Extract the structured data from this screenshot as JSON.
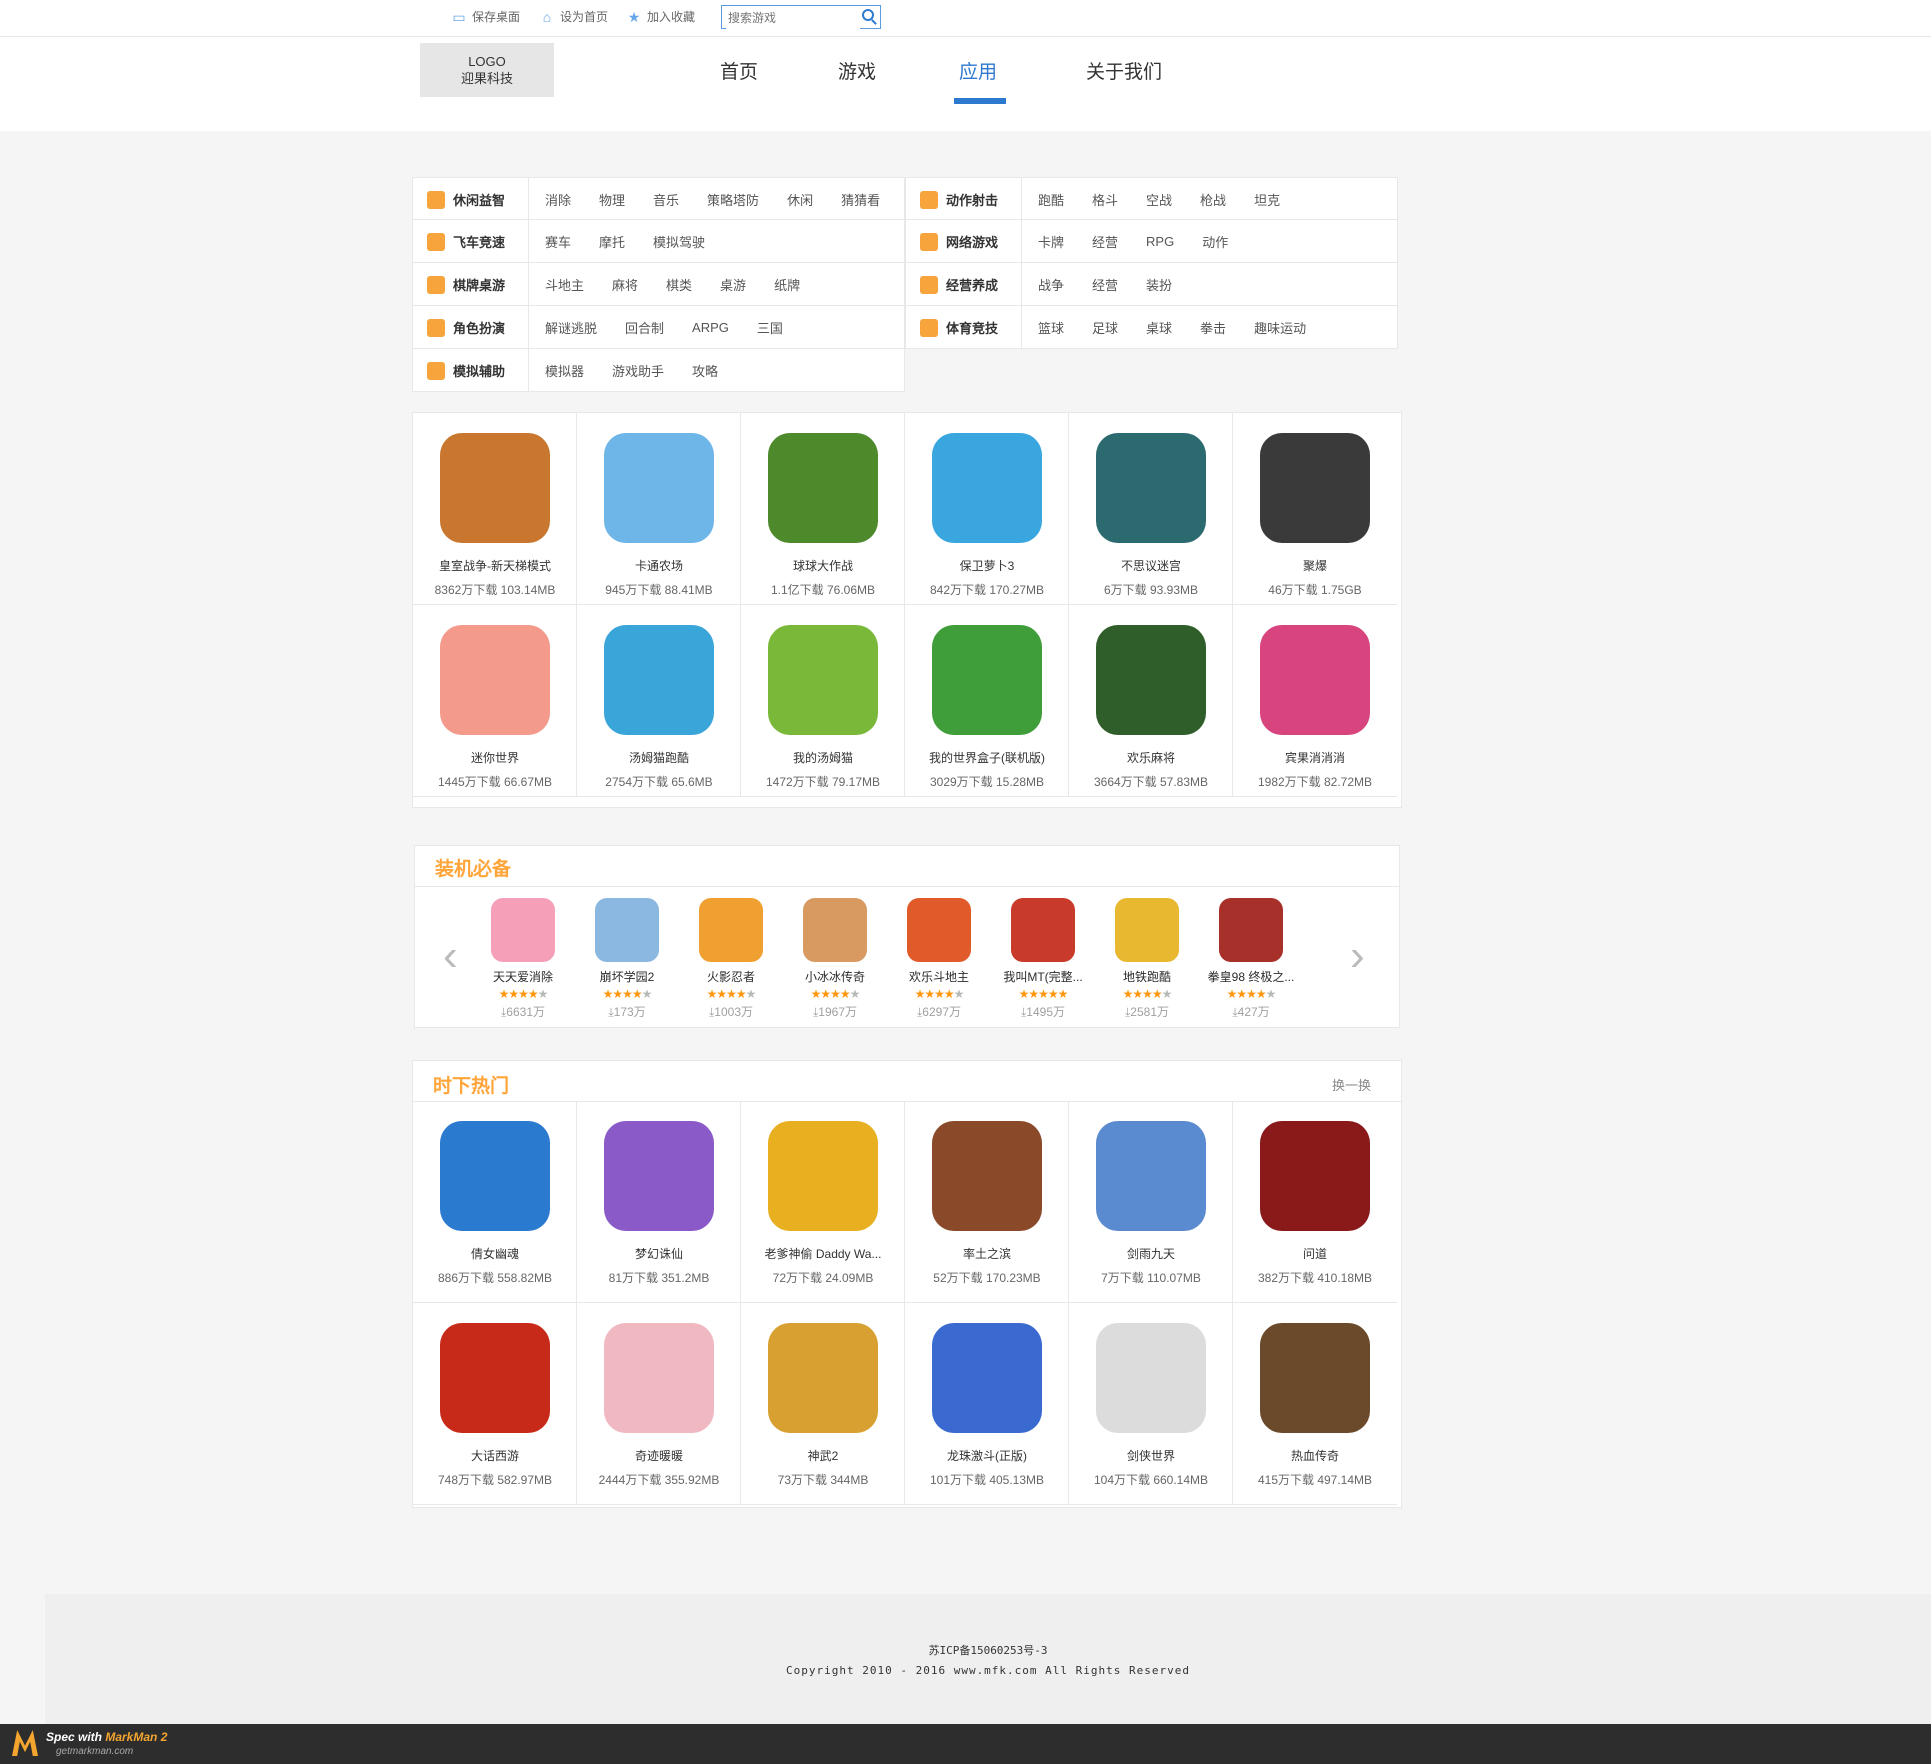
{
  "topbar": {
    "save_desktop": "保存桌面",
    "set_home": "设为首页",
    "add_favorite": "加入收藏",
    "search_placeholder": "搜索游戏"
  },
  "header": {
    "logo_line1": "LOGO",
    "logo_line2": "迎果科技",
    "nav": [
      {
        "label": "首页",
        "active": false
      },
      {
        "label": "游戏",
        "active": false
      },
      {
        "label": "应用",
        "active": true
      },
      {
        "label": "关于我们",
        "active": false
      }
    ]
  },
  "categories": {
    "left": [
      {
        "title": "休闲益智",
        "links": [
          "消除",
          "物理",
          "音乐",
          "策略塔防",
          "休闲",
          "猜猜看"
        ]
      },
      {
        "title": "飞车竞速",
        "links": [
          "赛车",
          "摩托",
          "模拟驾驶"
        ]
      },
      {
        "title": "棋牌桌游",
        "links": [
          "斗地主",
          "麻将",
          "棋类",
          "桌游",
          "纸牌"
        ]
      },
      {
        "title": "角色扮演",
        "links": [
          "解谜逃脱",
          "回合制",
          "ARPG",
          "三国"
        ]
      },
      {
        "title": "模拟辅助",
        "links": [
          "模拟器",
          "游戏助手",
          "攻略"
        ]
      }
    ],
    "right": [
      {
        "title": "动作射击",
        "links": [
          "跑酷",
          "格斗",
          "空战",
          "枪战",
          "坦克"
        ]
      },
      {
        "title": "网络游戏",
        "links": [
          "卡牌",
          "经营",
          "RPG",
          "动作"
        ]
      },
      {
        "title": "经营养成",
        "links": [
          "战争",
          "经营",
          "装扮"
        ]
      },
      {
        "title": "体育竞技",
        "links": [
          "篮球",
          "足球",
          "桌球",
          "拳击",
          "趣味运动"
        ]
      }
    ]
  },
  "apps_top": [
    {
      "name": "皇室战争-新天梯模式",
      "meta": "8362万下载 103.14MB",
      "color": "#c9762e"
    },
    {
      "name": "卡通农场",
      "meta": "945万下载 88.41MB",
      "color": "#6fb6e8"
    },
    {
      "name": "球球大作战",
      "meta": "1.1亿下载 76.06MB",
      "color": "#4c8a2c"
    },
    {
      "name": "保卫萝卜3",
      "meta": "842万下载 170.27MB",
      "color": "#39a6e0"
    },
    {
      "name": "不思议迷宫",
      "meta": "6万下载 93.93MB",
      "color": "#2b6a6e"
    },
    {
      "name": "聚爆",
      "meta": "46万下载 1.75GB",
      "color": "#3a3a3a"
    },
    {
      "name": "迷你世界",
      "meta": "1445万下载 66.67MB",
      "color": "#f39a8a"
    },
    {
      "name": "汤姆猫跑酷",
      "meta": "2754万下载 65.6MB",
      "color": "#3aa5d8"
    },
    {
      "name": "我的汤姆猫",
      "meta": "1472万下载 79.17MB",
      "color": "#7ab83a"
    },
    {
      "name": "我的世界盒子(联机版)",
      "meta": "3029万下载 15.28MB",
      "color": "#3f9e3a"
    },
    {
      "name": "欢乐麻将",
      "meta": "3664万下载 57.83MB",
      "color": "#2f5e2a"
    },
    {
      "name": "宾果消消消",
      "meta": "1982万下载 82.72MB",
      "color": "#d8457e"
    }
  ],
  "must_have": {
    "title": "装机必备",
    "apps": [
      {
        "name": "天天爱消除",
        "stars": 4,
        "downloads": "6631万",
        "color": "#f5a0b8"
      },
      {
        "name": "崩坏学园2",
        "stars": 4,
        "downloads": "173万",
        "color": "#8ab8e0"
      },
      {
        "name": "火影忍者",
        "stars": 4,
        "downloads": "1003万",
        "color": "#f0a030"
      },
      {
        "name": "小冰冰传奇",
        "stars": 4,
        "downloads": "1967万",
        "color": "#d89a60"
      },
      {
        "name": "欢乐斗地主",
        "stars": 4,
        "downloads": "6297万",
        "color": "#e05a2a"
      },
      {
        "name": "我叫MT(完整...",
        "stars": 5,
        "downloads": "1495万",
        "color": "#c83a2a"
      },
      {
        "name": "地铁跑酷",
        "stars": 4,
        "downloads": "2581万",
        "color": "#e8b830"
      },
      {
        "name": "拳皇98 终极之...",
        "stars": 4,
        "downloads": "427万",
        "color": "#a8302a"
      }
    ]
  },
  "hot": {
    "title": "时下热门",
    "refresh": "换一换",
    "apps": [
      {
        "name": "倩女幽魂",
        "meta": "886万下载 558.82MB",
        "color": "#2a7ad0"
      },
      {
        "name": "梦幻诛仙",
        "meta": "81万下载 351.2MB",
        "color": "#8a5ac8"
      },
      {
        "name": "老爹神偷 Daddy Wa...",
        "meta": "72万下载 24.09MB",
        "color": "#e8b020"
      },
      {
        "name": "率土之滨",
        "meta": "52万下载 170.23MB",
        "color": "#8a4a2a"
      },
      {
        "name": "剑雨九天",
        "meta": "7万下载 110.07MB",
        "color": "#5a8ad0"
      },
      {
        "name": "问道",
        "meta": "382万下载 410.18MB",
        "color": "#8a1a1a"
      },
      {
        "name": "大话西游",
        "meta": "748万下载 582.97MB",
        "color": "#c82a1a"
      },
      {
        "name": "奇迹暖暖",
        "meta": "2444万下载 355.92MB",
        "color": "#f0b8c0"
      },
      {
        "name": "神武2",
        "meta": "73万下载 344MB",
        "color": "#d8a030"
      },
      {
        "name": "龙珠激斗(正版)",
        "meta": "101万下载 405.13MB",
        "color": "#3a6ad0"
      },
      {
        "name": "剑侠世界",
        "meta": "104万下载 660.14MB",
        "color": "#dcdcdc"
      },
      {
        "name": "热血传奇",
        "meta": "415万下载 497.14MB",
        "color": "#6a4a2a"
      }
    ]
  },
  "footer": {
    "icp": "苏ICP备15060253号-3",
    "copyright": "Copyright  2010 - 2016 www.mfk.com All Rights Reserved"
  },
  "watermark": {
    "line1_prefix": "Spec with ",
    "line1_brand": "MarkMan 2",
    "line2": "getmarkman.com"
  }
}
